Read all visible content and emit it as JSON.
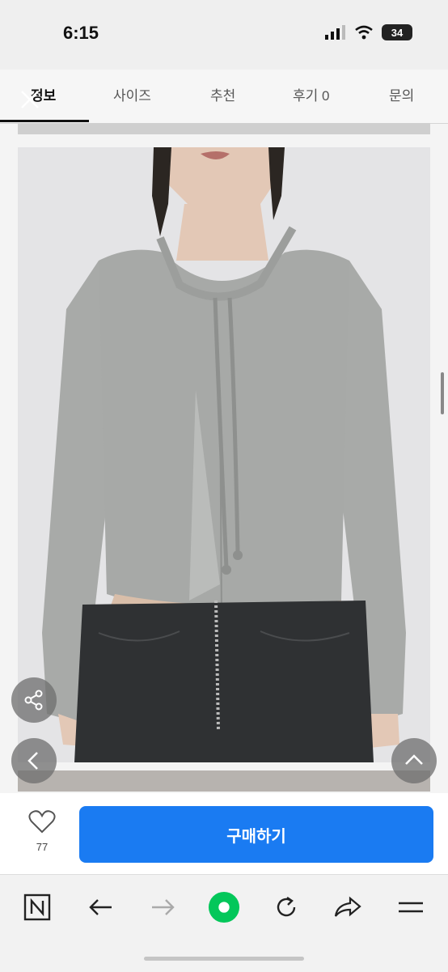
{
  "status_bar": {
    "time": "6:15",
    "battery_level": "34"
  },
  "tabs": [
    {
      "label": "정보",
      "active": true
    },
    {
      "label": "사이즈",
      "active": false
    },
    {
      "label": "추천",
      "active": false
    },
    {
      "label": "후기 0",
      "active": false
    },
    {
      "label": "문의",
      "active": false
    }
  ],
  "product": {
    "image_description": "product-photo-gray-drawstring-top",
    "like_count": "77",
    "buy_label": "구매하기"
  },
  "colors": {
    "accent": "#1a7bf2",
    "garment": "#a7a9a7",
    "naver_green": "#03c75a"
  },
  "browser": {
    "icons": [
      "naver-n-icon",
      "back-arrow-icon",
      "forward-arrow-icon",
      "naver-green-dot-icon",
      "refresh-icon",
      "share-icon",
      "menu-icon"
    ]
  }
}
